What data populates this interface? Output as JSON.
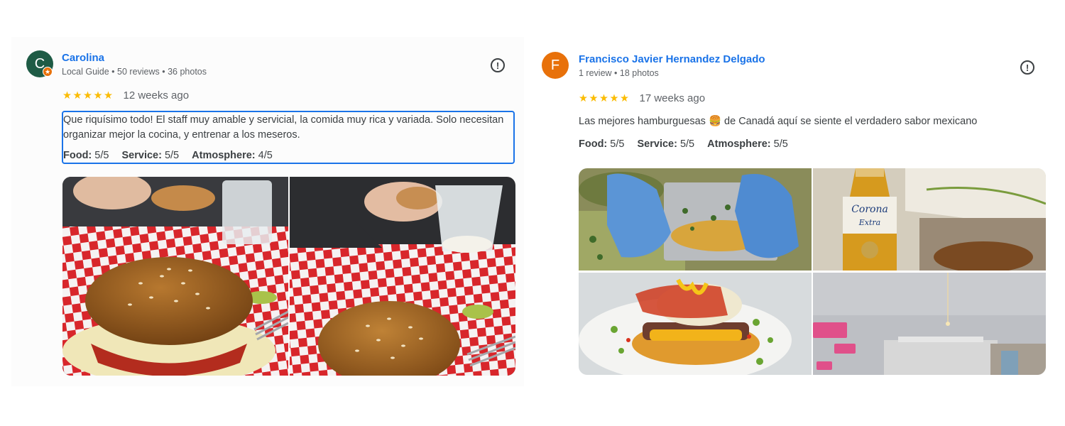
{
  "reviews": [
    {
      "author": "Carolina",
      "avatar_letter": "C",
      "avatar_color": "#1e5b45",
      "badge_icon": "local-guide-star-icon",
      "meta": "Local Guide • 50 reviews • 36 photos",
      "stars": "★★★★★",
      "rating": 5,
      "time": "12 weeks ago",
      "text": "Que riquísimo todo! El staff muy amable y servicial, la comida muy rica y variada. Solo necesitan organizar mejor la cocina, y entrenar a los meseros.",
      "attributes": [
        {
          "label": "Food:",
          "value": "5/5"
        },
        {
          "label": "Service:",
          "value": "5/5"
        },
        {
          "label": "Atmosphere:",
          "value": "4/5"
        }
      ],
      "photos": [
        "burger-on-checkered-paper",
        "burger-with-drink"
      ]
    },
    {
      "author": "Francisco Javier Hernandez Delgado",
      "avatar_letter": "F",
      "avatar_color": "#e8710a",
      "meta": "1 review • 18 photos",
      "stars": "★★★★★",
      "rating": 5,
      "time": "17 weeks ago",
      "text": "Las mejores hamburguesas 🍔 de Canadá aquí se siente el verdadero sabor mexicano",
      "attributes": [
        {
          "label": "Food:",
          "value": "5/5"
        },
        {
          "label": "Service:",
          "value": "5/5"
        },
        {
          "label": "Atmosphere:",
          "value": "5/5"
        }
      ],
      "photos": [
        "tacos-gloved-hands",
        "corona-beer-bottle",
        "loaded-burger-plate",
        "restaurant-interior-wall"
      ]
    }
  ],
  "report_icon": "report-flag-icon",
  "accent_color": "#1a73e8",
  "star_color": "#fbbc04"
}
